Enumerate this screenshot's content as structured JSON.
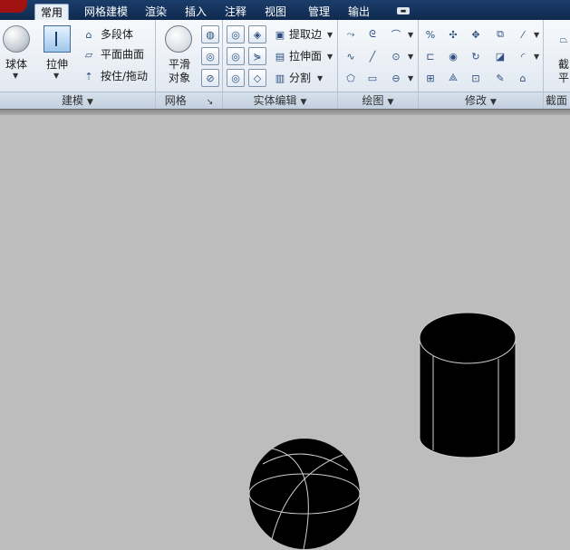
{
  "tabs": [
    "常用",
    "网格建模",
    "渲染",
    "插入",
    "注释",
    "视图",
    "管理",
    "输出"
  ],
  "active_tab": "常用",
  "panels": {
    "modeling": {
      "title": "建模",
      "sphere_label": "球体",
      "extrude_label": "拉伸",
      "polysolid_label": "多段体",
      "planar_surface_label": "平面曲面",
      "presspull_label": "按住/拖动"
    },
    "mesh": {
      "title": "网格",
      "smooth_label": "平滑\n对象",
      "smooth_line1": "平滑",
      "smooth_line2": "对象"
    },
    "solid_editing": {
      "title": "实体编辑",
      "extract_edges_label": "提取边",
      "extrude_faces_label": "拉伸面",
      "separate_label": "分割"
    },
    "draw": {
      "title": "绘图"
    },
    "modify": {
      "title": "修改"
    },
    "section": {
      "title": "截面",
      "section_plane_line1": "截",
      "section_plane_line2": "平"
    }
  },
  "viewport": {
    "objects": [
      "sphere",
      "cylinder"
    ],
    "background": "#bdbdbd",
    "object_fill": "#000000",
    "isoline_color": "#cfcfcf"
  }
}
